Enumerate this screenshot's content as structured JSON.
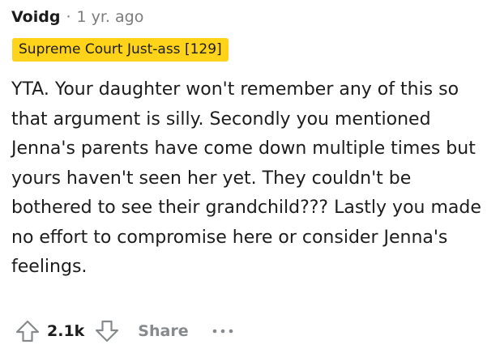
{
  "comment": {
    "username": "Voidg",
    "separator": "·",
    "age": "1 yr. ago",
    "flair": {
      "text": "Supreme Court Just-ass [129]",
      "background": "#ffd31a"
    },
    "body": "YTA. Your daughter won't remember any of this so that argument is silly. Secondly you mentioned Jenna's parents have come down multiple times but yours haven't seen her yet. They couldn't be bothered to see their grandchild??? Lastly you made no effort to compromise here or consider Jenna's feelings.",
    "actions": {
      "upvote_icon": "arrow-up-outline",
      "score": "2.1k",
      "downvote_icon": "arrow-down-outline",
      "share_label": "Share",
      "more_icon": "ellipsis-horizontal"
    }
  },
  "colors": {
    "text": "#1c1c1c",
    "muted": "#7c7c7c",
    "icon": "#878a8c"
  }
}
